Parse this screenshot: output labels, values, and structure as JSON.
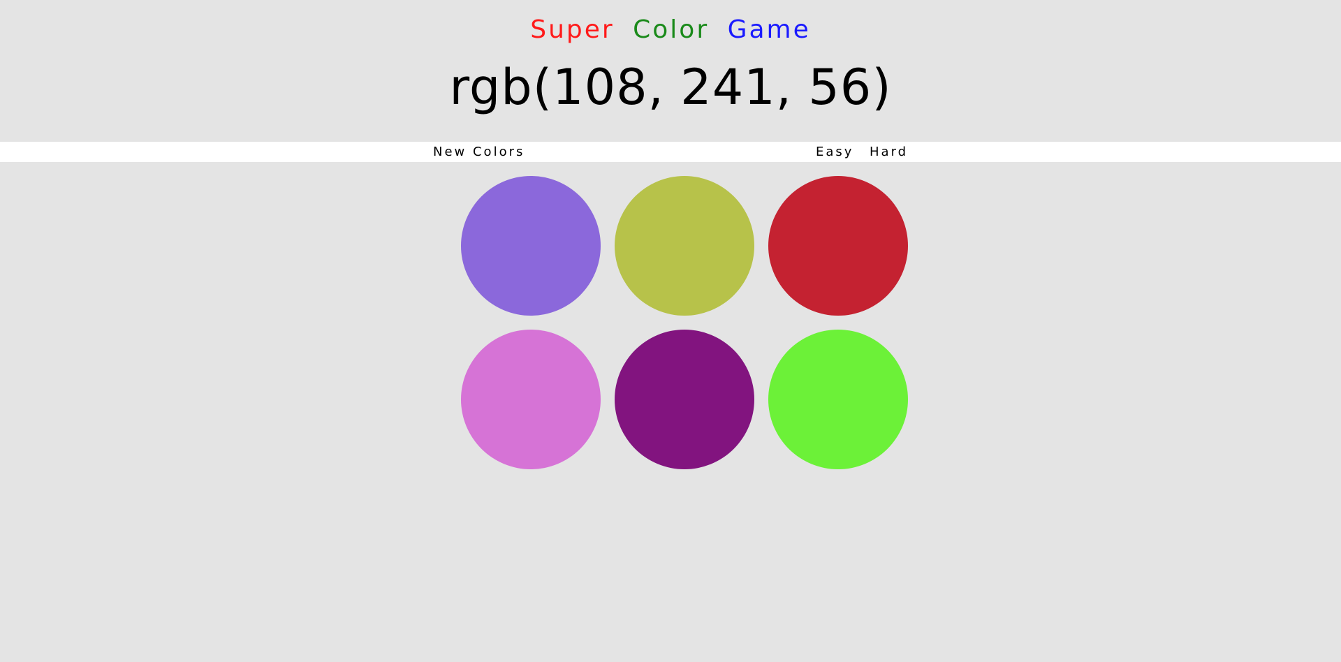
{
  "title": {
    "words": [
      {
        "text": "Super",
        "color": "#ff1a1a"
      },
      {
        "text": "Color",
        "color": "#1a8a1a"
      },
      {
        "text": "Game",
        "color": "#1a1aff"
      }
    ]
  },
  "target_color": "rgb(108, 241, 56)",
  "controls": {
    "new_colors_label": "New Colors",
    "easy_label": "Easy",
    "hard_label": "Hard"
  },
  "squares": [
    {
      "color": "#8b68db"
    },
    {
      "color": "#b7c24a"
    },
    {
      "color": "#c42231"
    },
    {
      "color": "#d673d6"
    },
    {
      "color": "#82147f"
    },
    {
      "color": "#6cf138"
    }
  ]
}
